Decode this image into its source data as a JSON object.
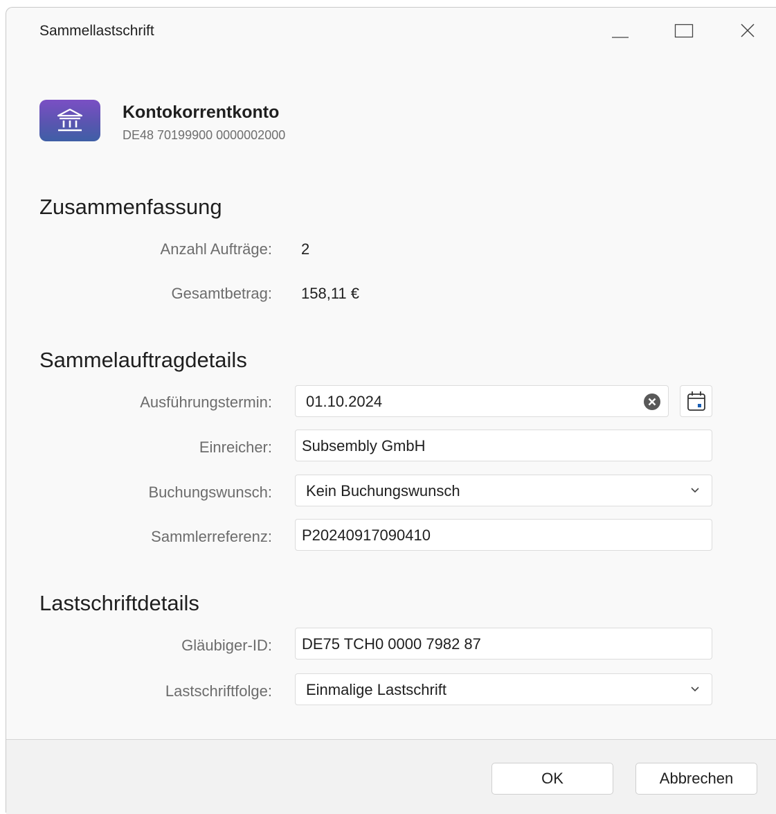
{
  "window": {
    "title": "Sammellastschrift"
  },
  "account": {
    "name": "Kontokorrentkonto",
    "iban": "DE48 70199900 0000002000",
    "icon": "bank-icon"
  },
  "summary": {
    "heading": "Zusammenfassung",
    "count_label": "Anzahl Aufträge:",
    "count_value": "2",
    "total_label": "Gesamtbetrag:",
    "total_value": "158,11 €"
  },
  "batch": {
    "heading": "Sammelauftragdetails",
    "exec_label": "Ausführungstermin:",
    "exec_value": "01.10.2024",
    "submitter_label": "Einreicher:",
    "submitter_value": "Subsembly GmbH",
    "booking_label": "Buchungswunsch:",
    "booking_value": "Kein Buchungswunsch",
    "ref_label": "Sammlerreferenz:",
    "ref_value": "P20240917090410"
  },
  "debit": {
    "heading": "Lastschriftdetails",
    "creditor_label": "Gläubiger-ID:",
    "creditor_value": "DE75 TCH0 0000 7982 87",
    "sequence_label": "Lastschriftfolge:",
    "sequence_value": "Einmalige Lastschrift"
  },
  "footer": {
    "ok_label": "OK",
    "cancel_label": "Abbrechen"
  },
  "colors": {
    "icon_gradient_top": "#7a4fc4",
    "icon_gradient_bottom": "#3f5fa6",
    "clear_icon": "#595959"
  }
}
